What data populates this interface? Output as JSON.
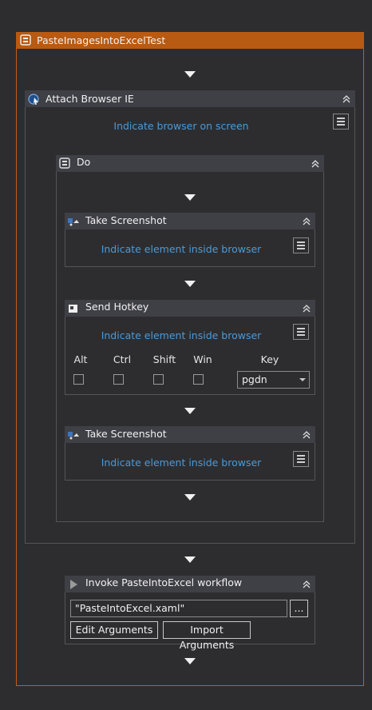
{
  "workflow": {
    "title": "PasteImagesIntoExcelTest"
  },
  "attach_browser": {
    "title": "Attach Browser IE",
    "indicate_label": "Indicate browser on screen"
  },
  "do_block": {
    "title": "Do"
  },
  "take_screenshot_1": {
    "title": "Take Screenshot",
    "indicate_label": "Indicate element inside browser"
  },
  "send_hotkey": {
    "title": "Send Hotkey",
    "indicate_label": "Indicate element inside browser",
    "modifiers": {
      "alt": "Alt",
      "ctrl": "Ctrl",
      "shift": "Shift",
      "win": "Win"
    },
    "key_label": "Key",
    "key_value": "pgdn"
  },
  "take_screenshot_2": {
    "title": "Take Screenshot",
    "indicate_label": "Indicate element inside browser"
  },
  "invoke_workflow": {
    "title": "Invoke PasteIntoExcel workflow",
    "file_value": "\"PasteIntoExcel.xaml\"",
    "browse_label": "...",
    "edit_arguments_label": "Edit Arguments",
    "import_arguments_label": "Import Arguments"
  },
  "colors": {
    "accent": "#c45d17",
    "header": "#3f3f46",
    "link": "#4a9ad8",
    "background": "#2d2d30"
  }
}
